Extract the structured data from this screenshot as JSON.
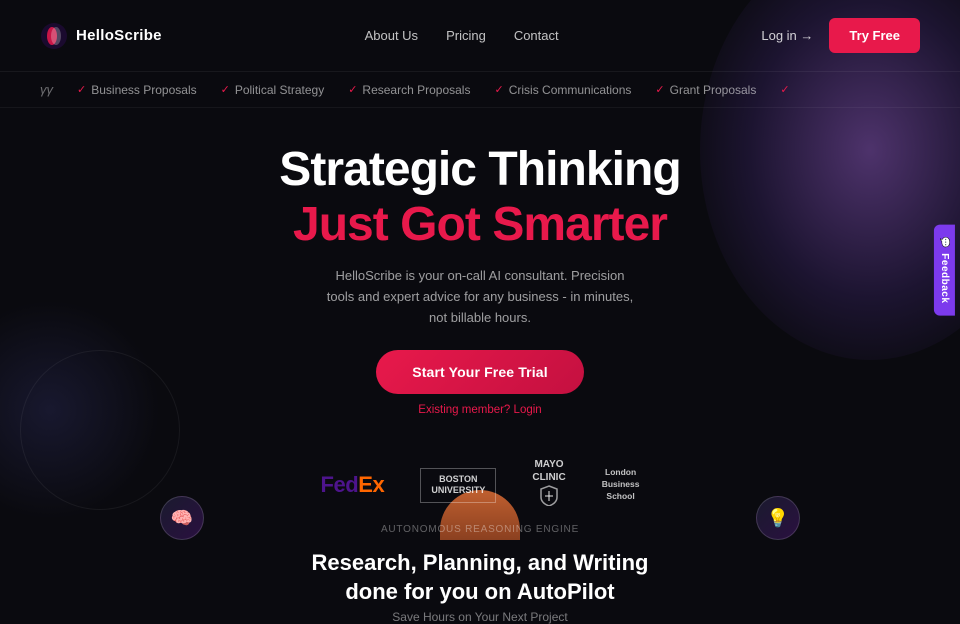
{
  "brand": {
    "name": "HelloScribe",
    "logo_alt": "HelloScribe logo"
  },
  "nav": {
    "links": [
      {
        "label": "About Us",
        "id": "about-us"
      },
      {
        "label": "Pricing",
        "id": "pricing"
      },
      {
        "label": "Contact",
        "id": "contact"
      }
    ],
    "login_label": "Log in →",
    "try_free_label": "Try Free"
  },
  "ticker": {
    "items": [
      "Business Proposals",
      "Political Strategy",
      "Research Proposals",
      "Crisis Communications",
      "Grant Proposals"
    ]
  },
  "hero": {
    "title_line1": "Strategic Thinking",
    "title_line2": "Just Got Smarter",
    "subtitle": "HelloScribe is your on-call AI consultant. Precision tools and expert advice for any business - in minutes, not billable hours.",
    "cta_label": "Start Your Free Trial",
    "existing_member_text": "Existing member?",
    "login_link_text": "Login"
  },
  "logos": [
    {
      "id": "fedex",
      "text": "FedEx"
    },
    {
      "id": "boston",
      "line1": "BOSTON",
      "line2": "UNIVERSITY"
    },
    {
      "id": "mayo",
      "line1": "MAYO",
      "line2": "CLINIC"
    },
    {
      "id": "london",
      "line1": "London",
      "line2": "Business",
      "line3": "School"
    }
  ],
  "are": {
    "label": "Autonomous Reasoning Engine"
  },
  "bottom": {
    "heading_line1": "Research, Planning, and Writing",
    "heading_line2": "done for you on AutoPilot",
    "subtitle": "Save Hours on Your Next Project"
  },
  "feedback": {
    "label": "Feedback"
  },
  "icons": {
    "left_bottom": "🧠",
    "right_bottom": "💡"
  }
}
